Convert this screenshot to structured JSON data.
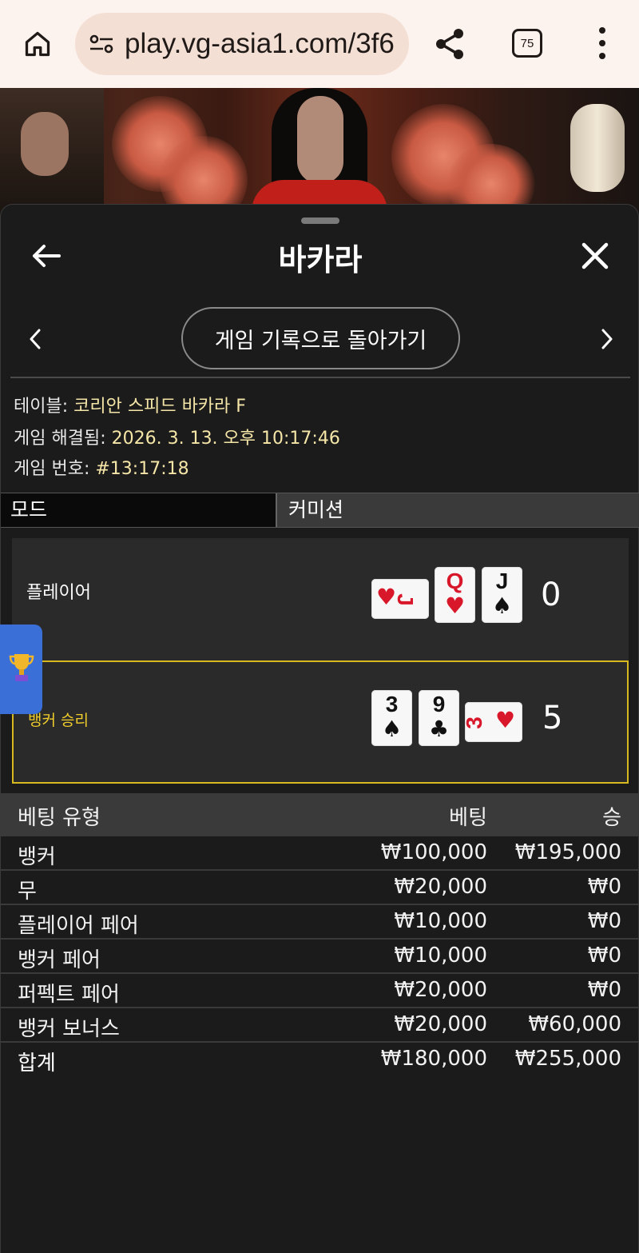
{
  "browser": {
    "url": "play.vg-asia1.com/3f6",
    "tab_count": "75"
  },
  "sheet": {
    "title": "바카라",
    "back_to_history": "게임 기록으로 돌아가기"
  },
  "info": {
    "table_label": "테이블:",
    "table_value": "코리안 스피드 바카라 F",
    "resolved_label": "게임 해결됨:",
    "resolved_value": "2026. 3. 13. 오후 10:17:46",
    "game_no_label": "게임 번호:",
    "game_no_value": "#13:17:18"
  },
  "mode": {
    "left": "모드",
    "right": "커미션"
  },
  "result": {
    "player": {
      "label": "플레이어",
      "score": "0",
      "cards": [
        {
          "rank": "J",
          "suit": "♥",
          "color": "red",
          "orientation": "sideways"
        },
        {
          "rank": "Q",
          "suit": "♥",
          "color": "red",
          "orientation": "upright"
        },
        {
          "rank": "J",
          "suit": "♠",
          "color": "black",
          "orientation": "upright"
        }
      ]
    },
    "banker": {
      "label": "뱅커 승리",
      "score": "5",
      "cards": [
        {
          "rank": "3",
          "suit": "♠",
          "color": "black",
          "orientation": "upright"
        },
        {
          "rank": "9",
          "suit": "♣",
          "color": "black",
          "orientation": "upright"
        },
        {
          "rank": "3",
          "suit": "♥",
          "color": "red",
          "orientation": "sideways"
        }
      ]
    }
  },
  "bets": {
    "headers": {
      "type": "베팅 유형",
      "bet": "베팅",
      "win": "승"
    },
    "rows": [
      {
        "type": "뱅커",
        "bet": "₩100,000",
        "win": "₩195,000"
      },
      {
        "type": "무",
        "bet": "₩20,000",
        "win": "₩0"
      },
      {
        "type": "플레이어 페어",
        "bet": "₩10,000",
        "win": "₩0"
      },
      {
        "type": "뱅커 페어",
        "bet": "₩10,000",
        "win": "₩0"
      },
      {
        "type": "퍼펙트 페어",
        "bet": "₩20,000",
        "win": "₩0"
      },
      {
        "type": "뱅커 보너스",
        "bet": "₩20,000",
        "win": "₩60,000"
      }
    ],
    "total": {
      "type": "합계",
      "bet": "₩180,000",
      "win": "₩255,000"
    }
  },
  "colors": {
    "accent_gold": "#d6b81f",
    "info_value": "#f5e6a8",
    "trophy_tab": "#3b6fd8"
  }
}
